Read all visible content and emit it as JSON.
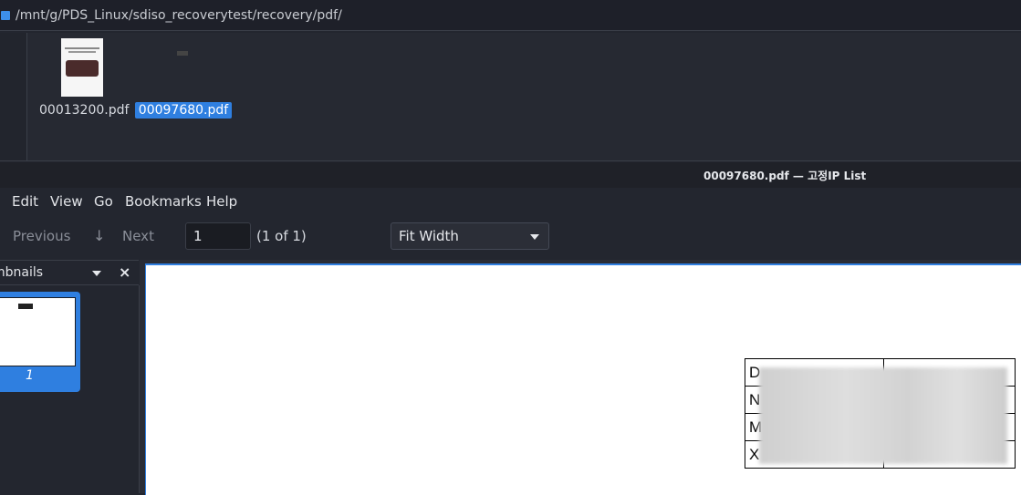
{
  "file_manager": {
    "path": "/mnt/g/PDS_Linux/sdiso_recoverytest/recovery/pdf/",
    "files": [
      {
        "name": "00013200.pdf",
        "selected": false
      },
      {
        "name": "00097680.pdf",
        "selected": true
      }
    ]
  },
  "viewer": {
    "window_title": "00097680.pdf — 고정IP List",
    "menu": [
      "Edit",
      "View",
      "Go",
      "Bookmarks",
      "Help"
    ],
    "toolbar": {
      "previous_label": "Previous",
      "next_label": "Next",
      "page_value": "1",
      "page_count": "(1 of 1)",
      "zoom_value": "Fit Width"
    },
    "sidebar": {
      "title": "mbnails",
      "thumbnails": [
        {
          "page_label": "1"
        }
      ]
    },
    "document": {
      "table_rows": [
        "D",
        "N",
        "M",
        "X"
      ]
    }
  },
  "colors": {
    "accent": "#2f7fe0",
    "background": "#23262f"
  }
}
